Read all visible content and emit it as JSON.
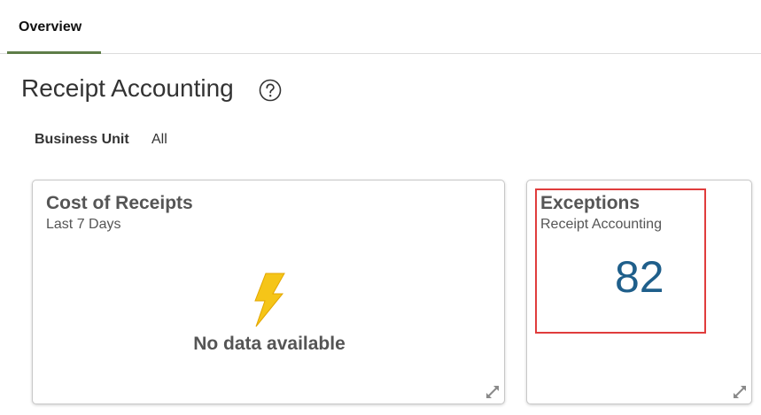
{
  "tabs": [
    {
      "label": "Overview",
      "active": true
    }
  ],
  "page": {
    "title": "Receipt Accounting"
  },
  "filter": {
    "label": "Business Unit",
    "value": "All"
  },
  "cards": {
    "cost_of_receipts": {
      "title": "Cost of Receipts",
      "subtitle": "Last 7 Days",
      "empty_message": "No data available",
      "icon": "lightning-bolt-icon"
    },
    "exceptions": {
      "title": "Exceptions",
      "subtitle": "Receipt Accounting",
      "value": "82"
    }
  },
  "colors": {
    "tab_underline": "#5e7d48",
    "metric": "#1f5f8b",
    "highlight": "#e03c3c",
    "bolt": "#f5c518"
  }
}
